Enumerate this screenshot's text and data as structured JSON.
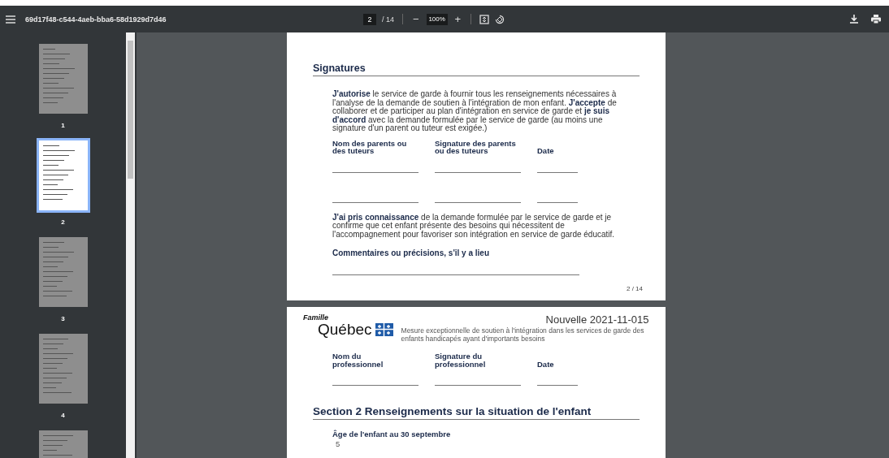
{
  "toolbar": {
    "title": "69d17f48-c544-4aeb-bba6-58d1929d7d46",
    "page_input": "2",
    "page_total": "/ 14",
    "zoom_out": "−",
    "zoom": "100%",
    "zoom_in": "+"
  },
  "thumbnails": [
    {
      "label": "1",
      "selected": false
    },
    {
      "label": "2",
      "selected": true
    },
    {
      "label": "3",
      "selected": false
    },
    {
      "label": "4",
      "selected": false
    },
    {
      "selected": false
    }
  ],
  "page_1": {
    "heading": "Signatures",
    "consent": "**J'autorise** le service de garde à fournir tous les renseignements nécessaires à l'analyse de la demande de soutien à l'intégration de mon enfant. **J'accepte** de collaborer et de participer au plan d'intégration en service de garde et **je suis d'accord** avec la demande formulée par le service de garde (au moins une signature d'un parent ou tuteur est exigée.)",
    "columns": [
      "Nom des parents ou des tuteurs",
      "Signature des parents ou des tuteurs",
      "Date"
    ],
    "acknowledgement": "**J'ai pris connaissance** de la demande formulée par le service de garde et je confirme que cet enfant présente des besoins qui nécessitent de l'accompagnement pour favoriser son intégration en service de garde éducatif.",
    "comments_label": "Commentaires ou précisions, s'il y a lieu",
    "page_number": "2 / 14"
  },
  "page_2": {
    "logo_small": "Famille",
    "logo": "Québec",
    "notice": "Nouvelle 2021-11-015",
    "subtitle": "Mesure exceptionnelle de soutien à l'intégration dans les services de garde des enfants handicapés ayant d'importants besoins",
    "columns": [
      "Nom du professionnel",
      "Signature du professionnel",
      "Date"
    ],
    "section_heading": "Section 2 Renseignements sur la situation de l'enfant",
    "field_label": "Âge de l'enfant au 30 septembre",
    "field_value": "5"
  }
}
